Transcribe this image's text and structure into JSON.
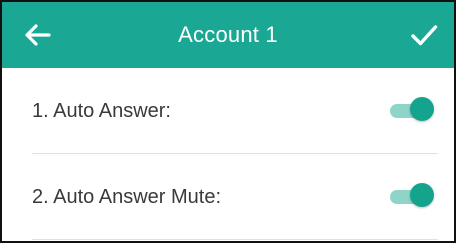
{
  "header": {
    "title": "Account 1",
    "back_icon": "arrow-left-icon",
    "confirm_icon": "check-icon",
    "background_color": "#1aa894"
  },
  "settings": {
    "items": [
      {
        "label": "1. Auto Answer:",
        "enabled": true
      },
      {
        "label": "2. Auto Answer Mute:",
        "enabled": true
      }
    ]
  },
  "colors": {
    "accent": "#14a48d",
    "toggle_track_on": "#8fd4c9",
    "label_text": "#3a3a3a"
  }
}
